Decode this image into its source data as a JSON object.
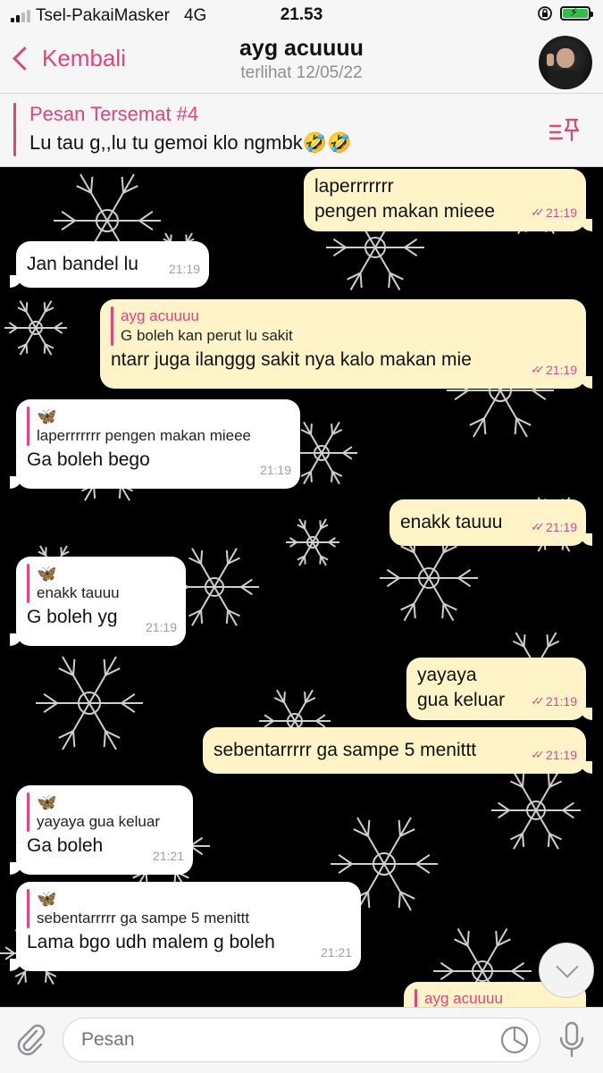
{
  "status_bar": {
    "carrier": "Tsel-PakaiMasker",
    "network": "4G",
    "time": "21.53"
  },
  "header": {
    "back_label": "Kembali",
    "chat_name": "ayg acuuuu",
    "last_seen": "terlihat 12/05/22"
  },
  "pinned": {
    "title": "Pesan Tersemat #4",
    "text": "Lu tau g,,lu tu gemoi klo ngmbk🤣🤣"
  },
  "messages": [
    {
      "dir": "out",
      "lines": [
        "laperrrrrrr",
        "pengen makan mieee"
      ],
      "time": "21:19"
    },
    {
      "dir": "in",
      "text": "Jan bandel lu",
      "time": "21:19"
    },
    {
      "dir": "out",
      "reply_name": "ayg acuuuu",
      "reply_text": "G boleh kan perut lu sakit",
      "text": "ntarr juga ilanggg sakit nya kalo makan mie",
      "time": "21:19"
    },
    {
      "dir": "in",
      "reply_name": "🦋",
      "reply_text": "laperrrrrrr pengen makan mieee",
      "text": "Ga boleh bego",
      "time": "21:19"
    },
    {
      "dir": "out",
      "text": "enakk tauuu",
      "time": "21:19"
    },
    {
      "dir": "in",
      "reply_name": "🦋",
      "reply_text": "enakk tauuu",
      "text": "G boleh yg",
      "time": "21:19"
    },
    {
      "dir": "out",
      "lines": [
        "yayaya",
        "gua keluar"
      ],
      "time": "21:19"
    },
    {
      "dir": "out",
      "text": "sebentarrrrr ga sampe 5 menittt",
      "time": "21:19"
    },
    {
      "dir": "in",
      "reply_name": "🦋",
      "reply_text": "yayaya gua keluar",
      "text": "Ga boleh",
      "time": "21:21"
    },
    {
      "dir": "in",
      "reply_name": "🦋",
      "reply_text": "sebentarrrrr ga sampe 5 menittt",
      "text": "Lama bgo udh malem g boleh",
      "time": "21:21"
    },
    {
      "dir": "out",
      "reply_name": "ayg acuuuu"
    }
  ],
  "input": {
    "placeholder": "Pesan"
  },
  "colors": {
    "accent": "#e0457c",
    "outgoing_bubble": "#fff4c8",
    "incoming_bubble": "#ffffff",
    "chat_background": "#000000"
  },
  "icons": [
    "back-chevron-icon",
    "pin-list-icon",
    "double-check-icon",
    "attach-icon",
    "sticker-icon",
    "mic-icon",
    "scroll-down-icon"
  ]
}
